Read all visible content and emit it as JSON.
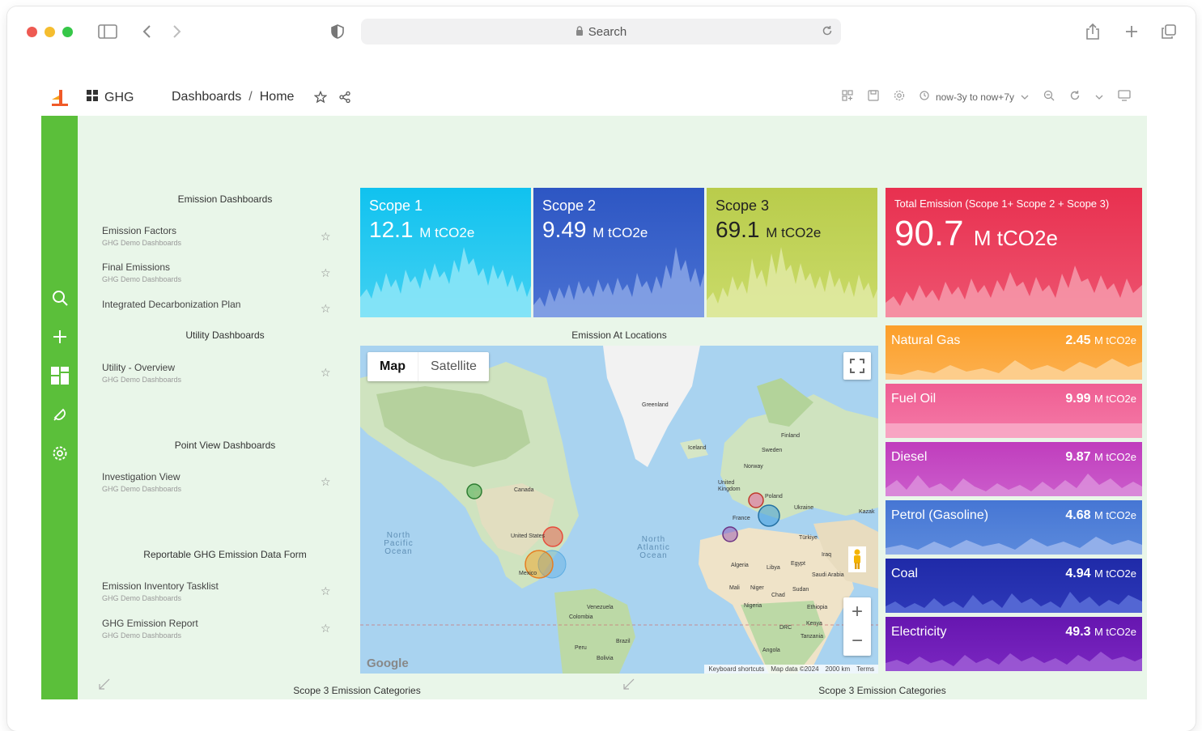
{
  "browser": {
    "search_placeholder": "Search"
  },
  "app": {
    "app_name": "GHG",
    "breadcrumb": {
      "parent": "Dashboards",
      "separator": "/",
      "current": "Home"
    },
    "time_range": "now-3y to now+7y"
  },
  "sections": {
    "emission": "Emission Dashboards",
    "utility": "Utility Dashboards",
    "point_view": "Point View Dashboards",
    "reportable": "Reportable GHG Emission Data Form"
  },
  "dashboards": {
    "emission_factors": {
      "title": "Emission Factors",
      "folder": "GHG Demo Dashboards"
    },
    "final_emissions": {
      "title": "Final Emissions",
      "folder": "GHG Demo Dashboards"
    },
    "integrated_plan": {
      "title": "Integrated Decarbonization Plan"
    },
    "utility_overview": {
      "title": "Utility - Overview",
      "folder": "GHG Demo Dashboards"
    },
    "investigation_view": {
      "title": "Investigation View",
      "folder": "GHG Demo Dashboards"
    },
    "inventory_tasklist": {
      "title": "Emission Inventory Tasklist",
      "folder": "GHG Demo Dashboards"
    },
    "ghg_report": {
      "title": "GHG Emission Report",
      "folder": "GHG Demo Dashboards"
    }
  },
  "scopes": {
    "scope1": {
      "label": "Scope 1",
      "value": "12.1",
      "unit": "M tCO2e",
      "color": "#1ec8ee"
    },
    "scope2": {
      "label": "Scope 2",
      "value": "9.49",
      "unit": "M tCO2e",
      "color": "#3a67cc"
    },
    "scope3": {
      "label": "Scope 3",
      "value": "69.1",
      "unit": "M tCO2e",
      "color": "#c3d259"
    },
    "total": {
      "label": "Total Emission (Scope 1+ Scope 2 + Scope 3)",
      "value": "90.7",
      "unit": "M tCO2e",
      "color": "#ea3c5b"
    }
  },
  "fuels": {
    "natural_gas": {
      "label": "Natural Gas",
      "value": "2.45",
      "unit": "M tCO2e",
      "color": "#fb9a2a"
    },
    "fuel_oil": {
      "label": "Fuel Oil",
      "value": "9.99",
      "unit": "M tCO2e",
      "color": "#f06295"
    },
    "diesel": {
      "label": "Diesel",
      "value": "9.87",
      "unit": "M tCO2e",
      "color": "#c23dbf"
    },
    "petrol": {
      "label": "Petrol (Gasoline)",
      "value": "4.68",
      "unit": "M tCO2e",
      "color": "#4a7ad6"
    },
    "coal": {
      "label": "Coal",
      "value": "4.94",
      "unit": "M tCO2e",
      "color": "#2631b2"
    },
    "electricity": {
      "label": "Electricity",
      "value": "49.3",
      "unit": "M tCO2e",
      "color": "#6b17b4"
    }
  },
  "map": {
    "title": "Emission At Locations",
    "toggle_map": "Map",
    "toggle_satellite": "Satellite",
    "zoom_in": "+",
    "zoom_out": "−",
    "google": "Google",
    "attr_shortcuts": "Keyboard shortcuts",
    "attr_data": "Map data ©2024",
    "attr_scale": "2000 km",
    "attr_terms": "Terms",
    "oceans": {
      "north_pacific": "North Pacific Ocean",
      "north_atlantic": "North Atlantic Ocean"
    },
    "countries": {
      "greenland": "Greenland",
      "iceland": "Iceland",
      "finland": "Finland",
      "sweden": "Sweden",
      "norway": "Norway",
      "uk": "United Kingdom",
      "poland": "Poland",
      "ukraine": "Ukraine",
      "kazak": "Kazak",
      "france": "France",
      "turkiye": "Türkiye",
      "iraq": "Iraq",
      "canada": "Canada",
      "united_states": "United States",
      "mexico": "Mexico",
      "algeria": "Algeria",
      "libya": "Libya",
      "egypt": "Egypt",
      "saudi": "Saudi Arabia",
      "mali": "Mali",
      "niger": "Niger",
      "chad": "Chad",
      "sudan": "Sudan",
      "nigeria": "Nigeria",
      "ethiopia": "Ethiopia",
      "venezuela": "Venezuela",
      "colombia": "Colombia",
      "kenya": "Kenya",
      "drc": "DRC",
      "tanzania": "Tanzania",
      "brazil": "Brazil",
      "peru": "Peru",
      "bolivia": "Bolivia",
      "angola": "Angola"
    }
  },
  "bottom_panels": {
    "left_title": "Scope 3 Emission Categories",
    "right_title": "Scope 3 Emission Categories"
  }
}
